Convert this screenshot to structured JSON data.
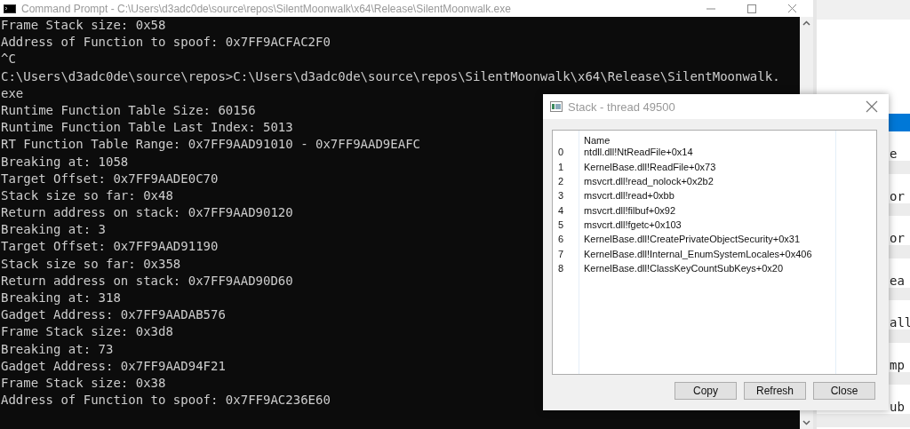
{
  "console": {
    "title": "Command Prompt - C:\\Users\\d3adc0de\\source\\repos\\SilentMoonwalk\\x64\\Release\\SilentMoonwalk.exe",
    "lines": [
      "Frame Stack size: 0x58",
      "Address of Function to spoof: 0x7FF9ACFAC2F0",
      "^C",
      "C:\\Users\\d3adc0de\\source\\repos>C:\\Users\\d3adc0de\\source\\repos\\SilentMoonwalk\\x64\\Release\\SilentMoonwalk.",
      "exe",
      "Runtime Function Table Size: 60156",
      "Runtime Function Table Last Index: 5013",
      "RT Function Table Range: 0x7FF9AAD91010 - 0x7FF9AAD9EAFC",
      "Breaking at: 1058",
      "Target Offset: 0x7FF9AADE0C70",
      "Stack size so far: 0x48",
      "Return address on stack: 0x7FF9AAD90120",
      "Breaking at: 3",
      "Target Offset: 0x7FF9AAD91190",
      "Stack size so far: 0x358",
      "Return address on stack: 0x7FF9AAD90D60",
      "Breaking at: 318",
      "Gadget Address: 0x7FF9AADAB576",
      "Frame Stack size: 0x3d8",
      "Breaking at: 73",
      "Gadget Address: 0x7FF9AAD94F21",
      "Frame Stack size: 0x38",
      "Address of Function to spoof: 0x7FF9AC236E60"
    ]
  },
  "background_window": {
    "fragments": [
      "e",
      "or",
      "or",
      "ea",
      "all",
      "mp",
      "ub"
    ]
  },
  "stack_dialog": {
    "title": "Stack - thread 49500",
    "columns": [
      "Name"
    ],
    "frames": [
      {
        "index": "0",
        "name": "ntdll.dll!NtReadFile+0x14"
      },
      {
        "index": "1",
        "name": "KernelBase.dll!ReadFile+0x73"
      },
      {
        "index": "2",
        "name": "msvcrt.dll!read_nolock+0x2b2"
      },
      {
        "index": "3",
        "name": "msvcrt.dll!read+0xbb"
      },
      {
        "index": "4",
        "name": "msvcrt.dll!filbuf+0x92"
      },
      {
        "index": "5",
        "name": "msvcrt.dll!fgetc+0x103"
      },
      {
        "index": "6",
        "name": "KernelBase.dll!CreatePrivateObjectSecurity+0x31"
      },
      {
        "index": "7",
        "name": "KernelBase.dll!Internal_EnumSystemLocales+0x406"
      },
      {
        "index": "8",
        "name": "KernelBase.dll!ClassKeyCountSubKeys+0x20"
      }
    ],
    "buttons": [
      "Copy",
      "Refresh",
      "Close"
    ]
  }
}
